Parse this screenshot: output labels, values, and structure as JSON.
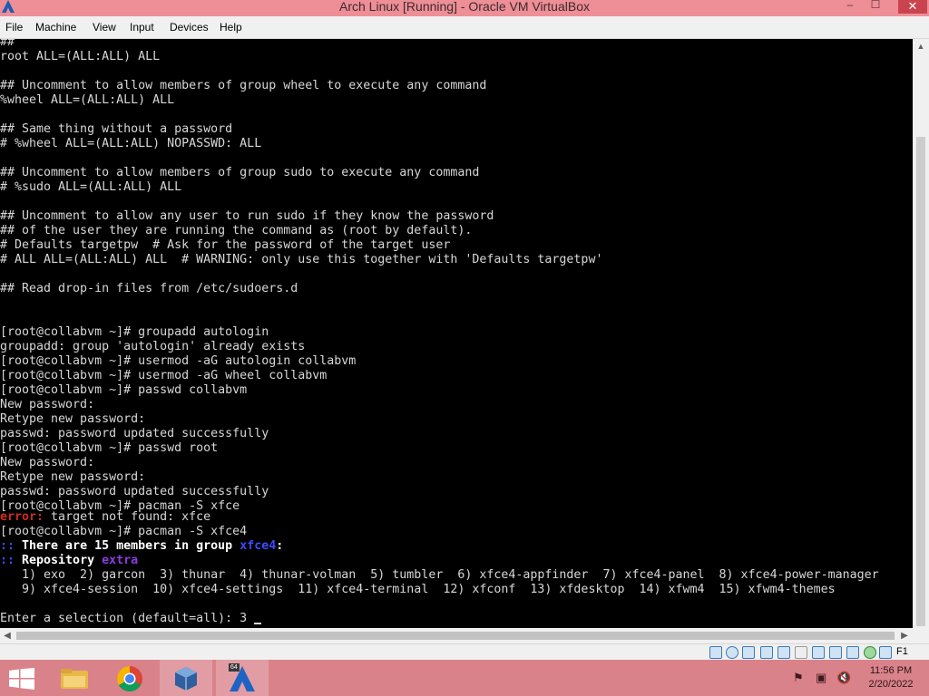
{
  "window": {
    "title": "Arch Linux [Running] - Oracle VM VirtualBox",
    "minimize": "–",
    "maximize": "☐",
    "close": "✕"
  },
  "menu": [
    "File",
    "Machine",
    "View",
    "Input",
    "Devices",
    "Help"
  ],
  "terminal": {
    "lines": [
      "##",
      "root ALL=(ALL:ALL) ALL",
      "",
      "## Uncomment to allow members of group wheel to execute any command",
      "%wheel ALL=(ALL:ALL) ALL",
      "",
      "## Same thing without a password",
      "# %wheel ALL=(ALL:ALL) NOPASSWD: ALL",
      "",
      "## Uncomment to allow members of group sudo to execute any command",
      "# %sudo ALL=(ALL:ALL) ALL",
      "",
      "## Uncomment to allow any user to run sudo if they know the password",
      "## of the user they are running the command as (root by default).",
      "# Defaults targetpw  # Ask for the password of the target user",
      "# ALL ALL=(ALL:ALL) ALL  # WARNING: only use this together with 'Defaults targetpw'",
      "",
      "## Read drop-in files from /etc/sudoers.d",
      "",
      "",
      "[root@collabvm ~]# groupadd autologin",
      "groupadd: group 'autologin' already exists",
      "[root@collabvm ~]# usermod -aG autologin collabvm",
      "[root@collabvm ~]# usermod -aG wheel collabvm",
      "[root@collabvm ~]# passwd collabvm",
      "New password:",
      "Retype new password:",
      "passwd: password updated successfully",
      "[root@collabvm ~]# passwd root",
      "New password:",
      "Retype new password:",
      "passwd: password updated successfully",
      "[root@collabvm ~]# pacman -S xfce"
    ],
    "error_prefix": "error:",
    "error_rest": " target not found: xfce",
    "cmd_xfce4": "[root@collabvm ~]# pacman -S xfce4",
    "members_colons": "::",
    "members_text": " There are 15 members in group ",
    "members_group": "xfce4",
    "members_end": ":",
    "repo_colons": "::",
    "repo_text": " Repository ",
    "repo_name": "extra",
    "options_line1": "   1) exo  2) garcon  3) thunar  4) thunar-volman  5) tumbler  6) xfce4-appfinder  7) xfce4-panel  8) xfce4-power-manager",
    "options_line2": "   9) xfce4-session  10) xfce4-settings  11) xfce4-terminal  12) xfconf  13) xfdesktop  14) xfwm4  15) xfwm4-themes",
    "prompt": "Enter a selection (default=all): 3 "
  },
  "statusbar": {
    "host_key": "F1"
  },
  "taskbar": {
    "time": "11:56 PM",
    "date": "2/20/2022",
    "badge": "64"
  },
  "colors": {
    "titlebar": "#ee8e96",
    "taskbar": "#d9828a",
    "terminal_bg": "#000000",
    "terminal_fg": "#d7d7d7",
    "error_red": "#d02c1c",
    "accent_blue": "#3a4cff",
    "accent_purple": "#8d3ae0"
  }
}
